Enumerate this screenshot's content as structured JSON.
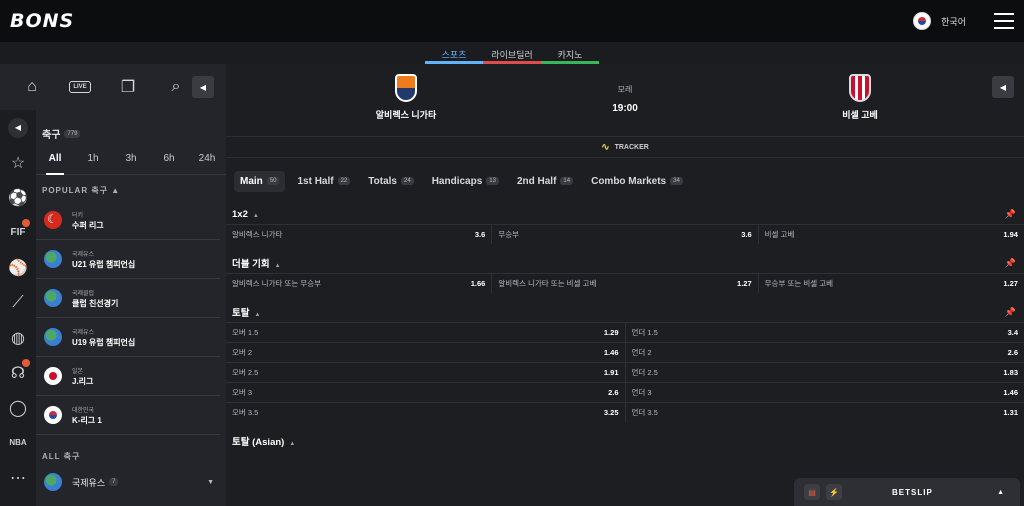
{
  "brand": {
    "logo": "BONS"
  },
  "header": {
    "language": "한국어"
  },
  "subnav": [
    {
      "label": "스포츠",
      "color": "#61b3ff",
      "active": true
    },
    {
      "label": "라이브딜러",
      "color": "#e04b4b",
      "active": false
    },
    {
      "label": "카지노",
      "color": "#38b65a",
      "active": false
    }
  ],
  "sidebar": {
    "sport_title": "축구",
    "sport_count": "779",
    "time_filters": [
      "All",
      "1h",
      "3h",
      "6h",
      "24h"
    ],
    "popular_header": "POPULAR 축구 ▲",
    "leagues": [
      {
        "country": "터키",
        "name": "수퍼 리그",
        "flag": "f-tr"
      },
      {
        "country": "국제유스",
        "name": "U21 유럽 챔피언십",
        "flag": "f-world"
      },
      {
        "country": "국제클럽",
        "name": "클럽 친선경기",
        "flag": "f-world"
      },
      {
        "country": "국제유스",
        "name": "U19 유럽 챔피언십",
        "flag": "f-world"
      },
      {
        "country": "일본",
        "name": "J.리그",
        "flag": "f-jp"
      },
      {
        "country": "대한민국",
        "name": "K-리그 1",
        "flag": "f-kr"
      }
    ],
    "all_header": "ALL 축구",
    "all_item": {
      "name": "국제유스",
      "count": "7"
    }
  },
  "match": {
    "home": "알비렉스 니가타",
    "away": "비셀 고베",
    "date": "모레",
    "time": "19:00",
    "tracker": "TRACKER"
  },
  "market_tabs": [
    {
      "label": "Main",
      "count": "50",
      "active": true
    },
    {
      "label": "1st Half",
      "count": "22",
      "active": false
    },
    {
      "label": "Totals",
      "count": "24",
      "active": false
    },
    {
      "label": "Handicaps",
      "count": "13",
      "active": false
    },
    {
      "label": "2nd Half",
      "count": "14",
      "active": false
    },
    {
      "label": "Combo Markets",
      "count": "34",
      "active": false
    }
  ],
  "markets": {
    "m1x2": {
      "title": "1x2",
      "rows": [
        [
          {
            "label": "알비렉스 니가타",
            "odd": "3.6"
          },
          {
            "label": "무승부",
            "odd": "3.6"
          },
          {
            "label": "비셀 고베",
            "odd": "1.94"
          }
        ]
      ]
    },
    "double": {
      "title": "더블 기회",
      "rows": [
        [
          {
            "label": "알비렉스 니가타 또는 무승부",
            "odd": "1.66"
          },
          {
            "label": "알비렉스 니가타 또는 비셀 고베",
            "odd": "1.27"
          },
          {
            "label": "무승부 또는 비셀 고베",
            "odd": "1.27"
          }
        ]
      ]
    },
    "totals": {
      "title": "토탈",
      "rows": [
        [
          {
            "label": "오버 1.5",
            "odd": "1.29"
          },
          {
            "label": "언더 1.5",
            "odd": "3.4"
          }
        ],
        [
          {
            "label": "오버 2",
            "odd": "1.46"
          },
          {
            "label": "언더 2",
            "odd": "2.6"
          }
        ],
        [
          {
            "label": "오버 2.5",
            "odd": "1.91"
          },
          {
            "label": "언더 2.5",
            "odd": "1.83"
          }
        ],
        [
          {
            "label": "오버 3",
            "odd": "2.6"
          },
          {
            "label": "언더 3",
            "odd": "1.46"
          }
        ],
        [
          {
            "label": "오버 3.5",
            "odd": "3.25"
          },
          {
            "label": "언더 3.5",
            "odd": "1.31"
          }
        ]
      ]
    },
    "asian": {
      "title": "토탈 (Asian)"
    }
  },
  "betslip": {
    "label": "BETSLIP"
  }
}
